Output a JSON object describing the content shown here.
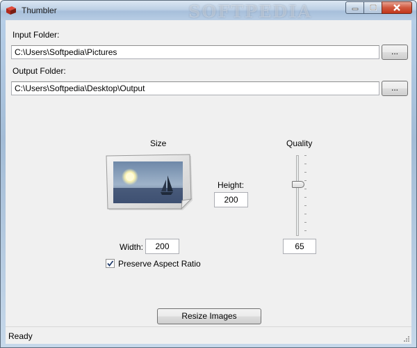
{
  "window": {
    "title": "Thumbler",
    "watermark": "SOFTPEDIA"
  },
  "input": {
    "label": "Input Folder:",
    "value": "C:\\Users\\Softpedia\\Pictures",
    "browse_label": "..."
  },
  "output": {
    "label": "Output Folder:",
    "value": "C:\\Users\\Softpedia\\Desktop\\Output",
    "browse_label": "..."
  },
  "size": {
    "label": "Size",
    "height_label": "Height:",
    "height_value": "200",
    "width_label": "Width:",
    "width_value": "200",
    "preserve_label": "Preserve Aspect Ratio",
    "preserve_checked": true
  },
  "quality": {
    "label": "Quality",
    "value": "65",
    "slider_level": 0.65
  },
  "actions": {
    "resize_label": "Resize Images"
  },
  "status": {
    "text": "Ready"
  },
  "colors": {
    "titlebar": "#bdd0e5",
    "close_button": "#c2371c",
    "client_bg": "#f0f0f0"
  },
  "icons": [
    "app-icon",
    "minimize-icon",
    "maximize-icon",
    "close-icon",
    "picture-icon",
    "checkmark-icon",
    "size-grip-icon"
  ]
}
